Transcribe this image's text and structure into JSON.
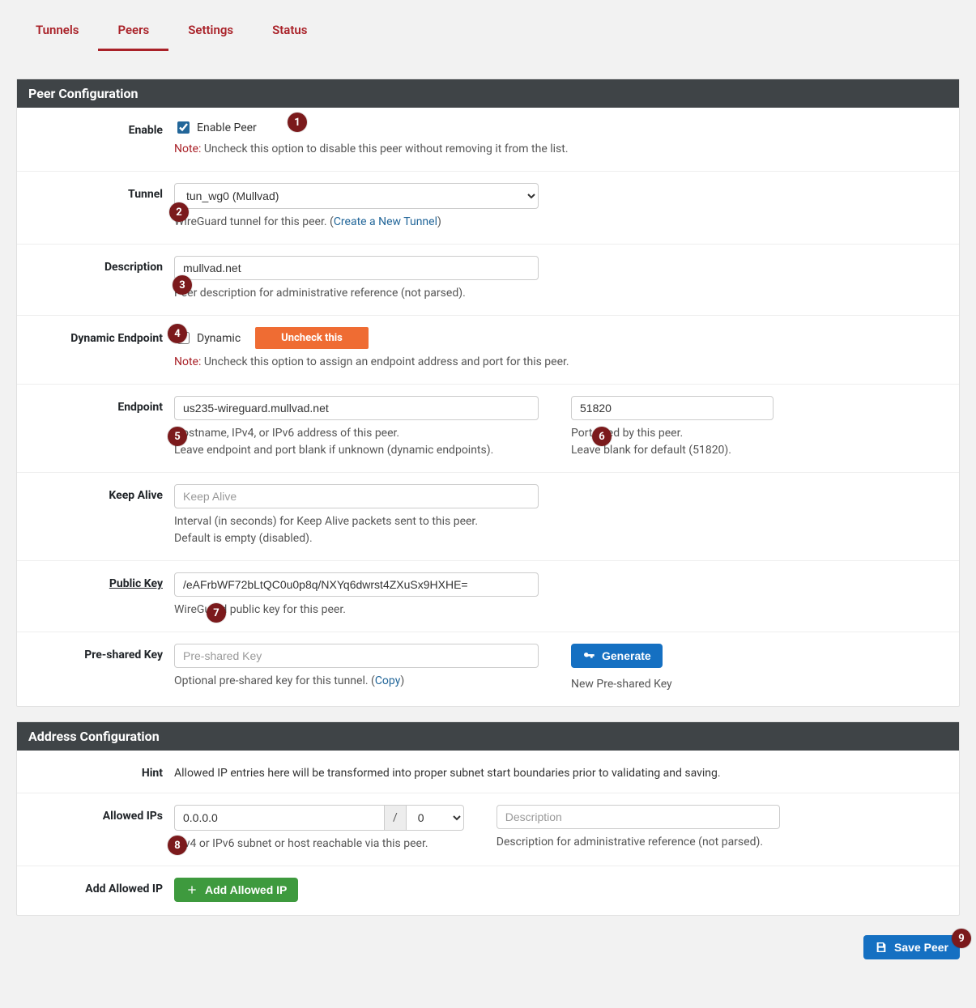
{
  "tabs": [
    "Tunnels",
    "Peers",
    "Settings",
    "Status"
  ],
  "activeTab": 1,
  "panel1": {
    "title": "Peer Configuration",
    "enable": {
      "label": "Enable",
      "cbLabel": "Enable Peer",
      "checked": true,
      "note": "Note:",
      "noteText": " Uncheck this option to disable this peer without removing it from the list."
    },
    "tunnel": {
      "label": "Tunnel",
      "value": "tun_wg0 (Mullvad)",
      "help1": "WireGuard tunnel for this peer. (",
      "link": "Create a New Tunnel",
      "help2": ")"
    },
    "description": {
      "label": "Description",
      "value": "mullvad.net",
      "help": "Peer description for administrative reference (not parsed)."
    },
    "dynamic": {
      "label": "Dynamic Endpoint",
      "cbLabel": "Dynamic",
      "pill": "Uncheck this",
      "note": "Note:",
      "noteText": " Uncheck this option to assign an endpoint address and port for this peer."
    },
    "endpoint": {
      "label": "Endpoint",
      "host": "us235-wireguard.mullvad.net",
      "hostHelp1": "Hostname, IPv4, or IPv6 address of this peer.",
      "hostHelp2": "Leave endpoint and port blank if unknown (dynamic endpoints).",
      "port": "51820",
      "portHelp1": "Port used by this peer.",
      "portHelp2": "Leave blank for default (51820)."
    },
    "keepalive": {
      "label": "Keep Alive",
      "placeholder": "Keep Alive",
      "help1": "Interval (in seconds) for Keep Alive packets sent to this peer.",
      "help2": "Default is empty (disabled)."
    },
    "pubkey": {
      "label": "Public Key",
      "value": "/eAFrbWF72bLtQC0u0p8q/NXYq6dwrst4ZXuSx9HXHE=",
      "help": "WireGuard public key for this peer."
    },
    "psk": {
      "label": "Pre-shared Key",
      "placeholder": "Pre-shared Key",
      "help1": "Optional pre-shared key for this tunnel. (",
      "copy": "Copy",
      "help2": ")",
      "btn": "Generate",
      "btnHelp": "New Pre-shared Key"
    }
  },
  "panel2": {
    "title": "Address Configuration",
    "hint": {
      "label": "Hint",
      "text": "Allowed IP entries here will be transformed into proper subnet start boundaries prior to validating and saving."
    },
    "allowed": {
      "label": "Allowed IPs",
      "ip": "0.0.0.0",
      "slash": "/",
      "cidr": "0",
      "ipHelp": "IPv4 or IPv6 subnet or host reachable via this peer.",
      "descPlaceholder": "Description",
      "descHelp": "Description for administrative reference (not parsed)."
    },
    "add": {
      "label": "Add Allowed IP",
      "btn": "Add Allowed IP"
    }
  },
  "save": "Save Peer",
  "markers": {
    "m1": "1",
    "m2": "2",
    "m3": "3",
    "m4": "4",
    "m5": "5",
    "m6": "6",
    "m7": "7",
    "m8": "8",
    "m9": "9"
  }
}
